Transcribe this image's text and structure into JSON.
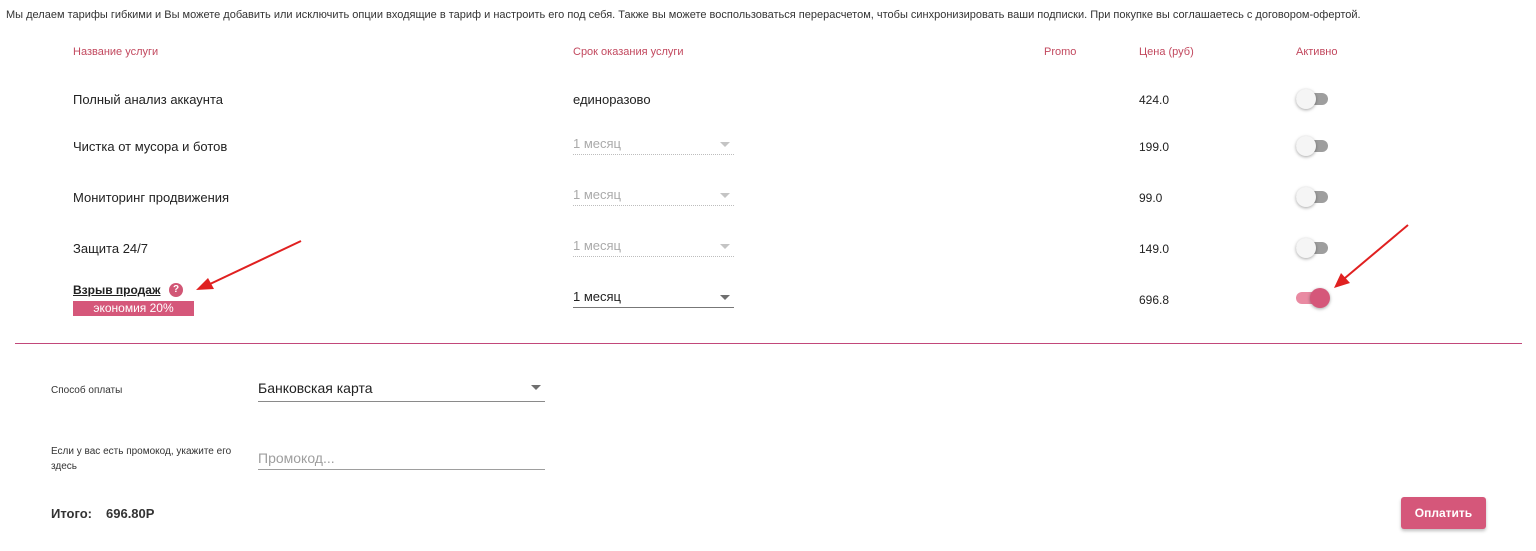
{
  "intro_text": "Мы делаем тарифы гибкими и Вы можете добавить или исключить опции входящие в тариф и настроить его под себя. Также вы можете воспользоваться перерасчетом, чтобы синхронизировать ваши подписки. При покупке вы соглашаетесь с договором-офертой.",
  "table": {
    "headers": {
      "name": "Название услуги",
      "period": "Срок оказания услуги",
      "promo": "Promo",
      "price": "Цена (руб)",
      "active": "Активно"
    },
    "rows": [
      {
        "name": "Полный анализ аккаунта",
        "period": "единоразово",
        "period_type": "text",
        "price": "424.0",
        "active": false
      },
      {
        "name": "Чистка от мусора и ботов",
        "period": "1 месяц",
        "period_type": "select-disabled",
        "price": "199.0",
        "active": false
      },
      {
        "name": "Мониторинг продвижения",
        "period": "1 месяц",
        "period_type": "select-disabled",
        "price": "99.0",
        "active": false
      },
      {
        "name": "Защита 24/7",
        "period": "1 месяц",
        "period_type": "select-disabled",
        "price": "149.0",
        "active": false
      },
      {
        "name": "Взрыв продаж",
        "period": "1 месяц",
        "period_type": "select",
        "price": "696.8",
        "active": true,
        "badge": "экономия 20%",
        "help_icon": "question-circle-icon"
      }
    ]
  },
  "payment": {
    "method_label": "Способ оплаты",
    "method_value": "Банковская карта",
    "promo_label": "Если у вас есть промокод, укажите его здесь",
    "promo_placeholder": "Промокод...",
    "promo_value": ""
  },
  "total": {
    "label": "Итого:",
    "value": "696.80Р"
  },
  "pay_button": "Оплатить",
  "colors": {
    "accent": "#d5577a",
    "header_text": "#c2485e",
    "toggle_on_track": "#e98aa2",
    "toggle_off_track": "#9e9e9e",
    "annotation_arrow": "#e02020"
  }
}
